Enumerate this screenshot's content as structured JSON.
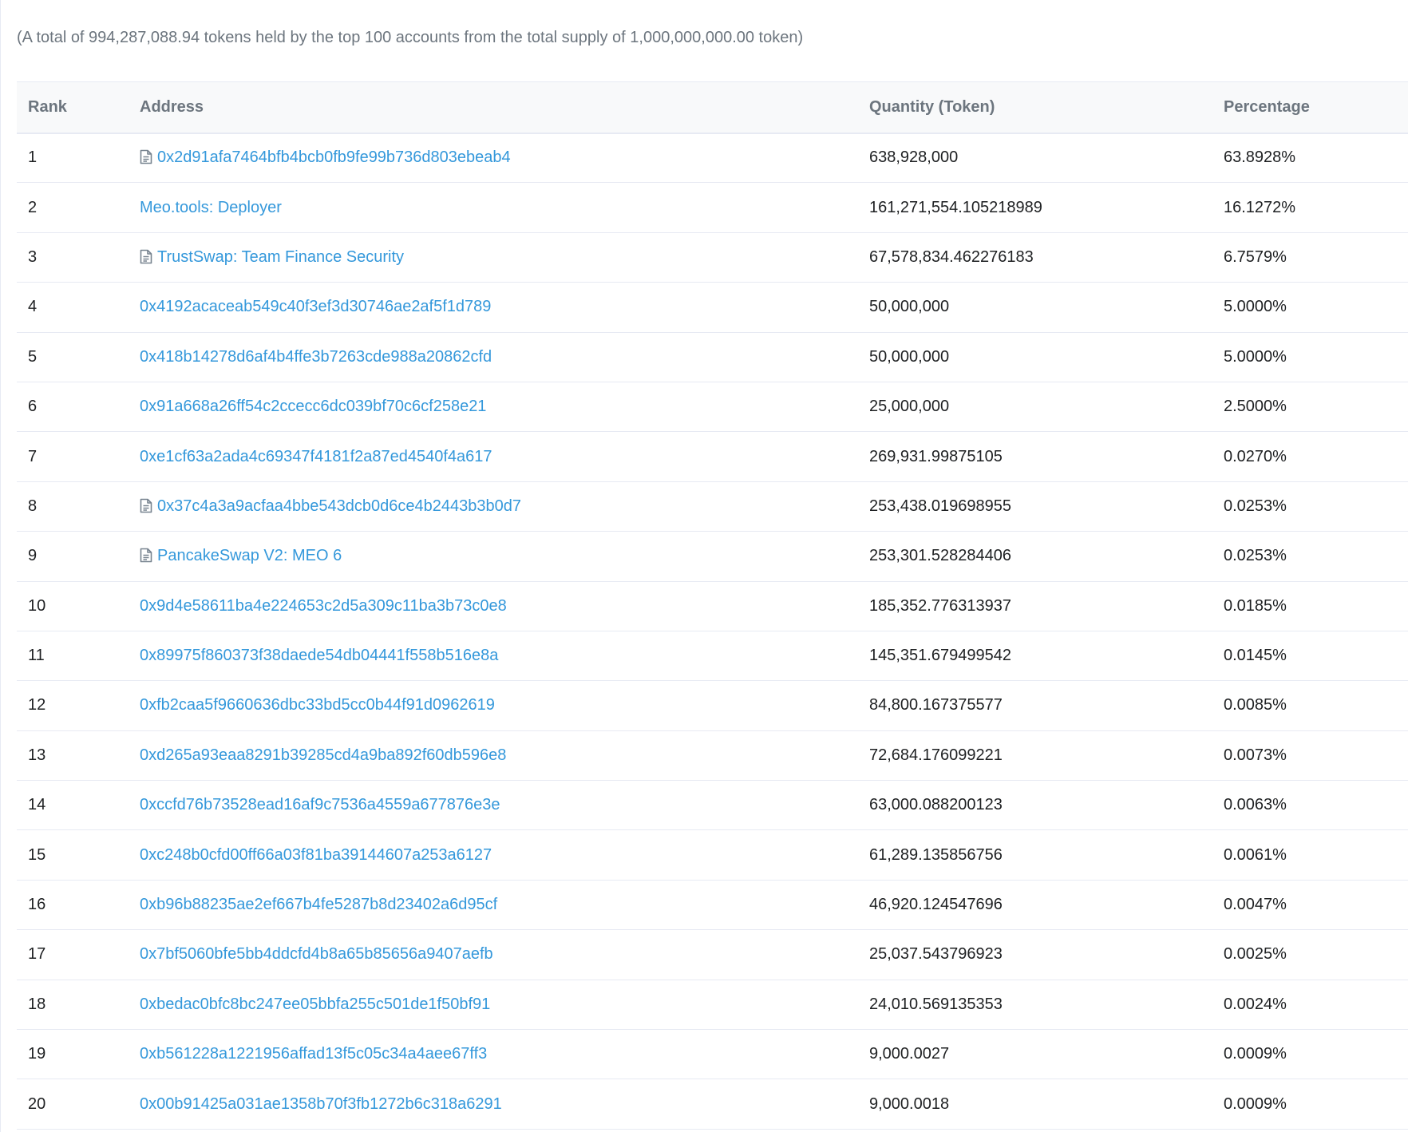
{
  "summary_text": "(A total of 994,287,088.94 tokens held by the top 100 accounts from the total supply of 1,000,000,000.00 token)",
  "table": {
    "headers": {
      "rank": "Rank",
      "address": "Address",
      "quantity": "Quantity (Token)",
      "percentage": "Percentage"
    },
    "rows": [
      {
        "rank": "1",
        "address": "0x2d91afa7464bfb4bcb0fb9fe99b736d803ebeab4",
        "contract": true,
        "quantity": "638,928,000",
        "percentage": "63.8928%"
      },
      {
        "rank": "2",
        "address": "Meo.tools: Deployer",
        "contract": false,
        "quantity": "161,271,554.105218989",
        "percentage": "16.1272%"
      },
      {
        "rank": "3",
        "address": "TrustSwap: Team Finance Security",
        "contract": true,
        "quantity": "67,578,834.462276183",
        "percentage": "6.7579%"
      },
      {
        "rank": "4",
        "address": "0x4192acaceab549c40f3ef3d30746ae2af5f1d789",
        "contract": false,
        "quantity": "50,000,000",
        "percentage": "5.0000%"
      },
      {
        "rank": "5",
        "address": "0x418b14278d6af4b4ffe3b7263cde988a20862cfd",
        "contract": false,
        "quantity": "50,000,000",
        "percentage": "5.0000%"
      },
      {
        "rank": "6",
        "address": "0x91a668a26ff54c2ccecc6dc039bf70c6cf258e21",
        "contract": false,
        "quantity": "25,000,000",
        "percentage": "2.5000%"
      },
      {
        "rank": "7",
        "address": "0xe1cf63a2ada4c69347f4181f2a87ed4540f4a617",
        "contract": false,
        "quantity": "269,931.99875105",
        "percentage": "0.0270%"
      },
      {
        "rank": "8",
        "address": "0x37c4a3a9acfaa4bbe543dcb0d6ce4b2443b3b0d7",
        "contract": true,
        "quantity": "253,438.019698955",
        "percentage": "0.0253%"
      },
      {
        "rank": "9",
        "address": "PancakeSwap V2: MEO 6",
        "contract": true,
        "quantity": "253,301.528284406",
        "percentage": "0.0253%"
      },
      {
        "rank": "10",
        "address": "0x9d4e58611ba4e224653c2d5a309c11ba3b73c0e8",
        "contract": false,
        "quantity": "185,352.776313937",
        "percentage": "0.0185%"
      },
      {
        "rank": "11",
        "address": "0x89975f860373f38daede54db04441f558b516e8a",
        "contract": false,
        "quantity": "145,351.679499542",
        "percentage": "0.0145%"
      },
      {
        "rank": "12",
        "address": "0xfb2caa5f9660636dbc33bd5cc0b44f91d0962619",
        "contract": false,
        "quantity": "84,800.167375577",
        "percentage": "0.0085%"
      },
      {
        "rank": "13",
        "address": "0xd265a93eaa8291b39285cd4a9ba892f60db596e8",
        "contract": false,
        "quantity": "72,684.176099221",
        "percentage": "0.0073%"
      },
      {
        "rank": "14",
        "address": "0xccfd76b73528ead16af9c7536a4559a677876e3e",
        "contract": false,
        "quantity": "63,000.088200123",
        "percentage": "0.0063%"
      },
      {
        "rank": "15",
        "address": "0xc248b0cfd00ff66a03f81ba39144607a253a6127",
        "contract": false,
        "quantity": "61,289.135856756",
        "percentage": "0.0061%"
      },
      {
        "rank": "16",
        "address": "0xb96b88235ae2ef667b4fe5287b8d23402a6d95cf",
        "contract": false,
        "quantity": "46,920.124547696",
        "percentage": "0.0047%"
      },
      {
        "rank": "17",
        "address": "0x7bf5060bfe5bb4ddcfd4b8a65b85656a9407aefb",
        "contract": false,
        "quantity": "25,037.543796923",
        "percentage": "0.0025%"
      },
      {
        "rank": "18",
        "address": "0xbedac0bfc8bc247ee05bbfa255c501de1f50bf91",
        "contract": false,
        "quantity": "24,010.569135353",
        "percentage": "0.0024%"
      },
      {
        "rank": "19",
        "address": "0xb561228a1221956affad13f5c05c34a4aee67ff3",
        "contract": false,
        "quantity": "9,000.0027",
        "percentage": "0.0009%"
      },
      {
        "rank": "20",
        "address": "0x00b91425a031ae1358b70f3fb1272b6c318a6291",
        "contract": false,
        "quantity": "9,000.0018",
        "percentage": "0.0009%"
      }
    ]
  }
}
